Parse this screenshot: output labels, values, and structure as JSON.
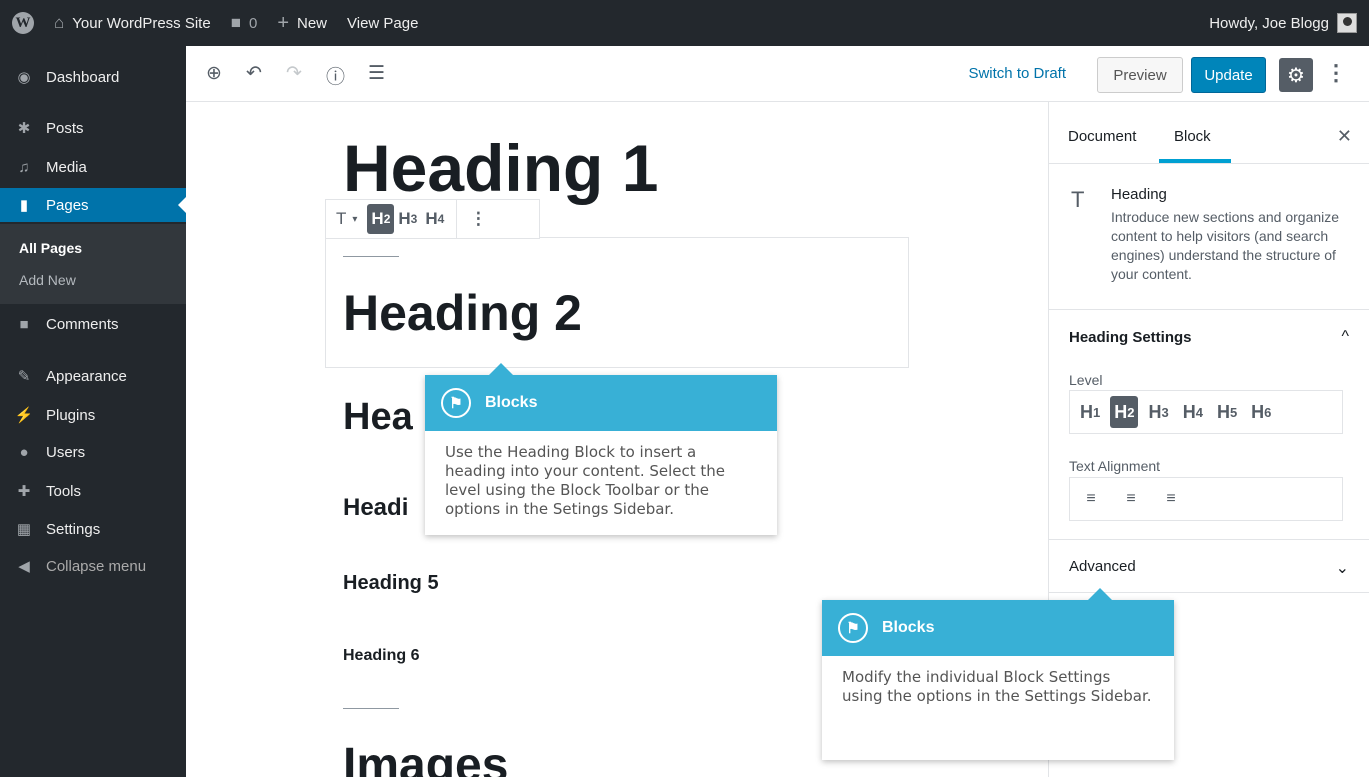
{
  "admin_bar": {
    "site_name": "Your WordPress Site",
    "comments_count": "0",
    "new_label": "New",
    "view_page_label": "View Page",
    "greeting": "Howdy, Joe Blogg"
  },
  "admin_menu": {
    "items": [
      {
        "label": "Dashboard"
      },
      {
        "label": "Posts"
      },
      {
        "label": "Media"
      },
      {
        "label": "Pages"
      },
      {
        "label": "Comments"
      },
      {
        "label": "Appearance"
      },
      {
        "label": "Plugins"
      },
      {
        "label": "Users"
      },
      {
        "label": "Tools"
      },
      {
        "label": "Settings"
      },
      {
        "label": "Collapse menu"
      }
    ],
    "submenu": [
      {
        "label": "All Pages"
      },
      {
        "label": "Add New"
      }
    ]
  },
  "editor_toolbar": {
    "switch_to_draft": "Switch to Draft",
    "preview": "Preview",
    "update": "Update"
  },
  "content": {
    "heading1": "Heading 1",
    "heading2": "Heading 2",
    "heading3": "Hea",
    "heading4": "Headi",
    "heading5": "Heading 5",
    "heading6": "Heading 6",
    "images": "Images"
  },
  "block_toolbar": {
    "type_icon": "T",
    "levels": [
      "H",
      "H",
      "H"
    ],
    "level_nums": [
      "2",
      "3",
      "4"
    ]
  },
  "sidebar": {
    "tabs": {
      "document": "Document",
      "block": "Block"
    },
    "block_card": {
      "title": "Heading",
      "description": "Introduce new sections and organize content to help visitors (and search engines) understand the structure of your content."
    },
    "heading_settings": {
      "title": "Heading Settings",
      "level_label": "Level",
      "levels": [
        "1",
        "2",
        "3",
        "4",
        "5",
        "6"
      ],
      "alignment_label": "Text Alignment"
    },
    "advanced": {
      "title": "Advanced"
    }
  },
  "popovers": [
    {
      "title": "Blocks",
      "body": "Use the Heading Block to insert a heading into your content. Select the level using the Block Toolbar or the options in the Setings Sidebar."
    },
    {
      "title": "Blocks",
      "body": "Modify the individual Block Settings using the options in the Settings Sidebar."
    }
  ]
}
